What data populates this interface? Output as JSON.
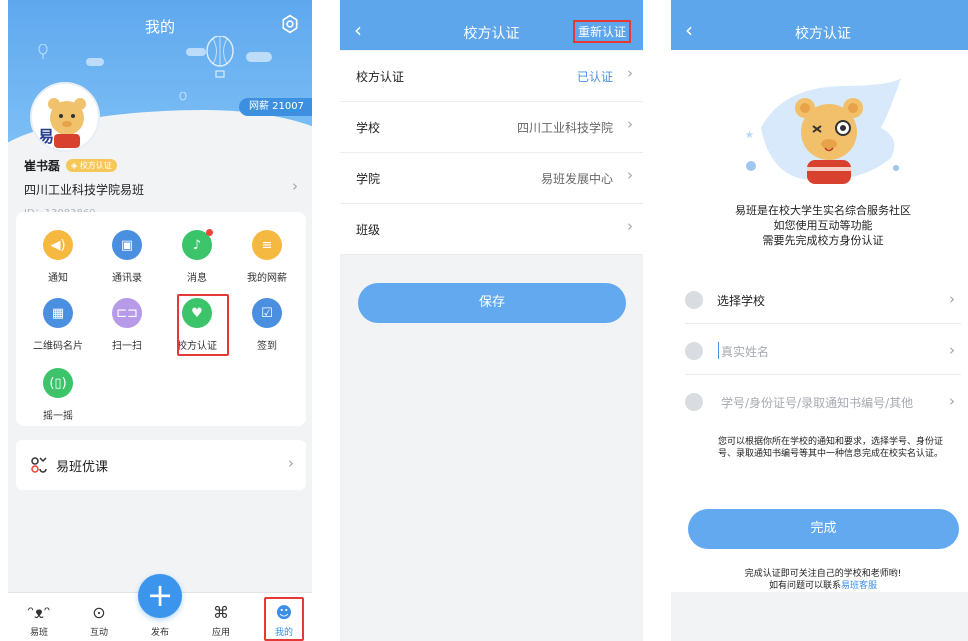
{
  "screen1": {
    "title": "我的",
    "wang_gold": "网薪 21007",
    "user": {
      "name": "崔书磊",
      "badge": "校方认证",
      "school_class": "四川工业科技学院易班",
      "id": "ID：13083860"
    },
    "grid": [
      {
        "label": "通知",
        "icon": "speaker-icon",
        "color": "#f5b942"
      },
      {
        "label": "通讯录",
        "icon": "contacts-icon",
        "color": "#4b8fe0"
      },
      {
        "label": "消息",
        "icon": "bell-icon",
        "color": "#3bc46a"
      },
      {
        "label": "我的网薪",
        "icon": "coins-icon",
        "color": "#f5b942"
      },
      {
        "label": "二维码名片",
        "icon": "qrcode-icon",
        "color": "#4b8fe0"
      },
      {
        "label": "扫一扫",
        "icon": "scan-icon",
        "color": "#b79be8"
      },
      {
        "label": "校方认证",
        "icon": "shield-check-icon",
        "color": "#3bc46a"
      },
      {
        "label": "签到",
        "icon": "calendar-check-icon",
        "color": "#4b8fe0"
      },
      {
        "label": "摇一摇",
        "icon": "shake-phone-icon",
        "color": "#3bc46a"
      }
    ],
    "course": {
      "label": "易班优课",
      "icon": "course-icon"
    },
    "tabs": [
      {
        "label": "易班",
        "icon": "bear-icon"
      },
      {
        "label": "互动",
        "icon": "chat-icon"
      },
      {
        "label": "发布",
        "icon": "plus-icon"
      },
      {
        "label": "应用",
        "icon": "apps-icon"
      },
      {
        "label": "我的",
        "icon": "profile-icon",
        "active": true
      }
    ]
  },
  "screen2": {
    "title": "校方认证",
    "back_icon": "back-icon",
    "re_auth": "重新认证",
    "rows": [
      {
        "key": "校方认证",
        "value": "已认证",
        "value_color": "#4a90e2"
      },
      {
        "key": "学校",
        "value": "四川工业科技学院"
      },
      {
        "key": "学院",
        "value": "易班发展中心"
      },
      {
        "key": "班级",
        "value": ""
      }
    ],
    "save": "保存"
  },
  "screen3": {
    "title": "校方认证",
    "back_icon": "back-icon",
    "intro": [
      "易班是在校大学生实名综合服务社区",
      "如您使用互动等功能",
      "需要先完成校方身份认证"
    ],
    "fields": [
      {
        "label": "选择学校",
        "placeholder": "",
        "icon": "school-icon"
      },
      {
        "label": "",
        "placeholder": "真实姓名",
        "icon": "person-icon"
      },
      {
        "label": "",
        "placeholder": "学号/身份证号/录取通知书编号/其他",
        "icon": "idcard-icon"
      }
    ],
    "hint": "您可以根据你所在学校的通知和要求，选择学号、身份证号、录取通知书编号等其中一种信息完成在校实名认证。",
    "done": "完成",
    "footer": {
      "line1": "完成认证即可关注自己的学校和老师哟!",
      "line2_prefix": "如有问题可以联系",
      "line2_link": "易班客服"
    },
    "colors": {
      "primary": "#5ea6ec",
      "button": "#63a9ef",
      "highlight": "#e53935"
    }
  }
}
